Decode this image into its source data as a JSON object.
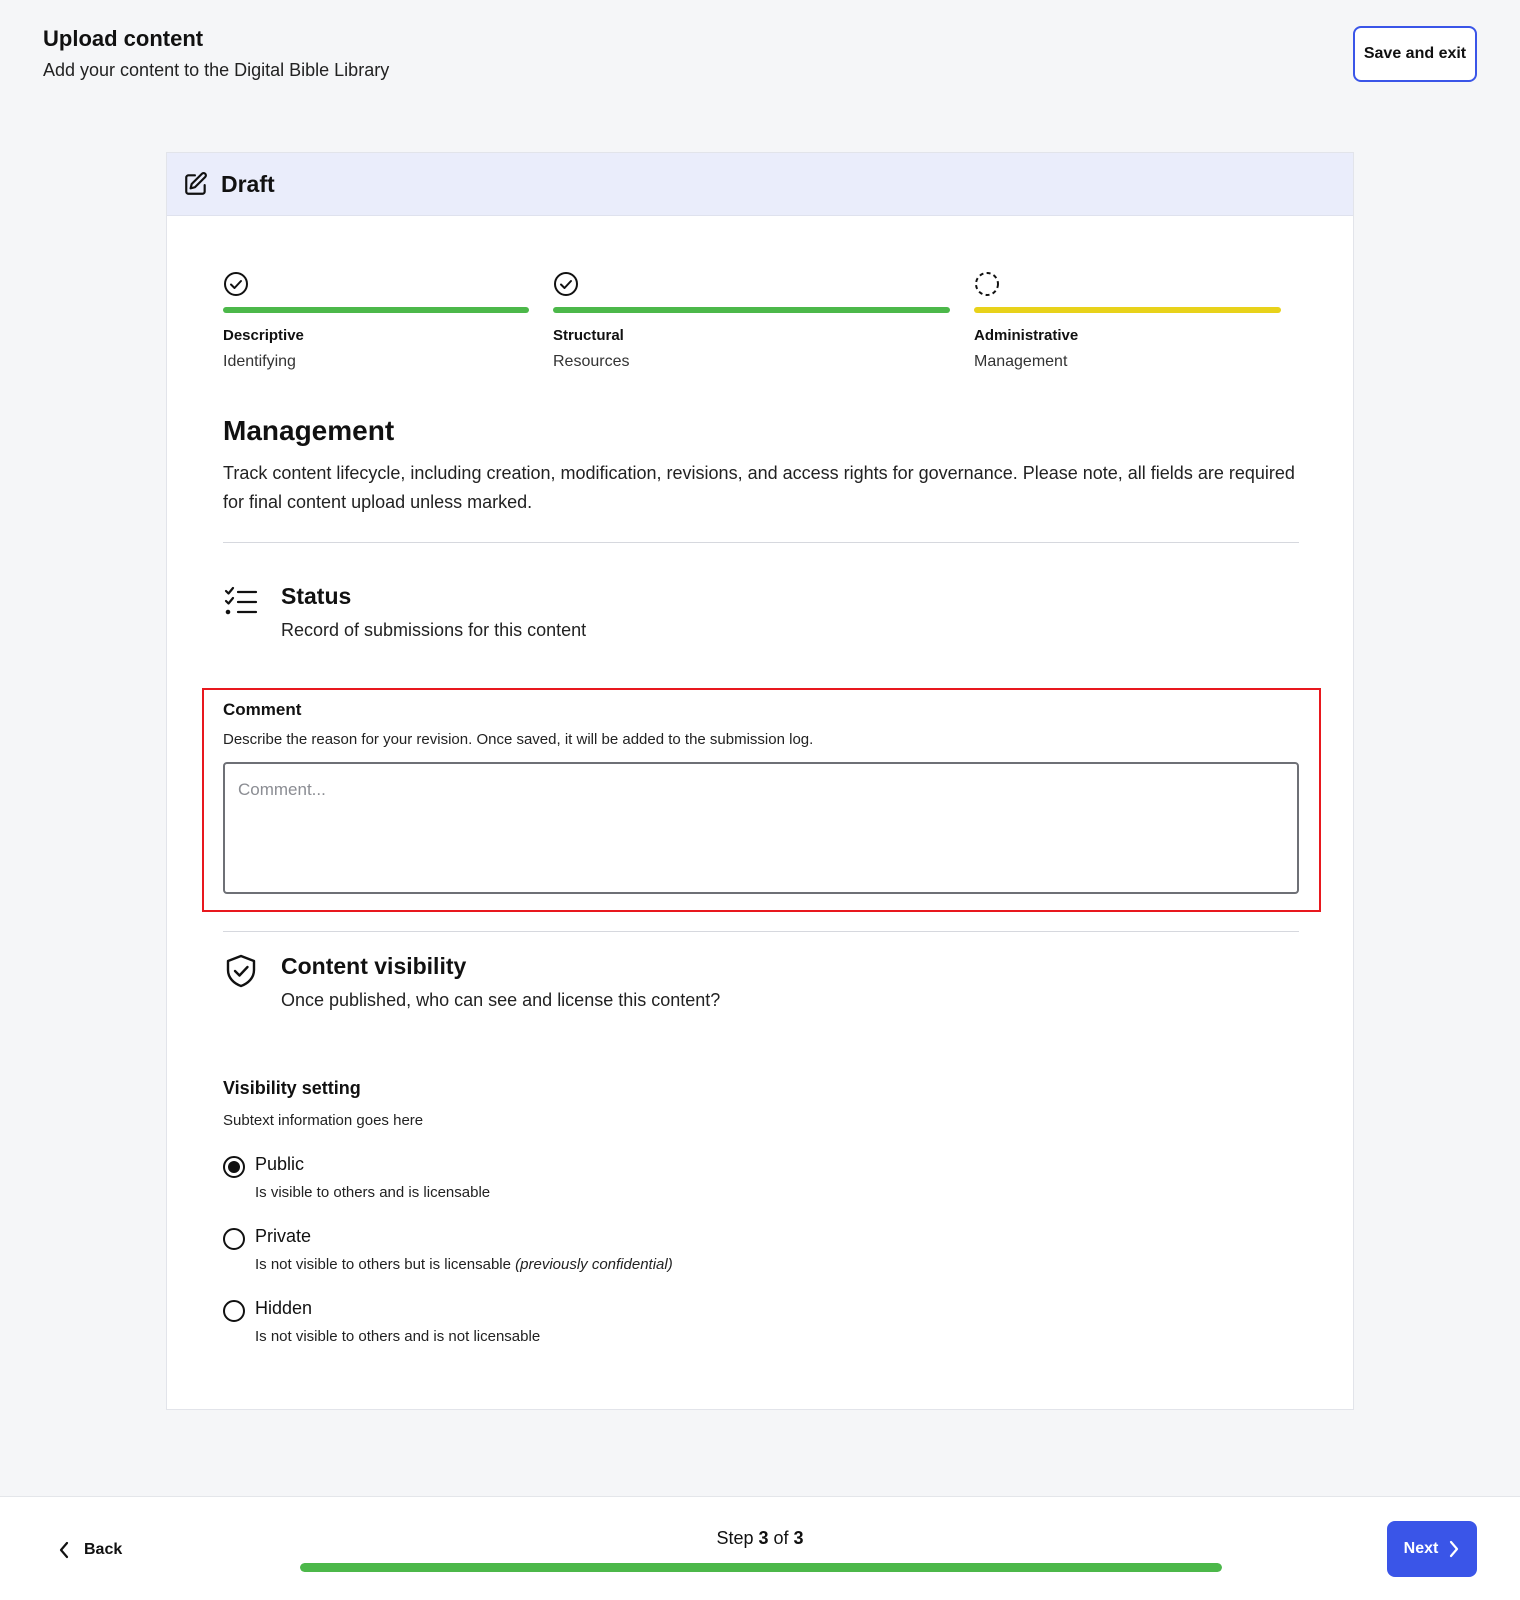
{
  "header": {
    "title": "Upload content",
    "subtitle": "Add your content to the Digital Bible Library",
    "save_exit_label": "Save and exit"
  },
  "card": {
    "status_label": "Draft",
    "status_icon": "edit-icon"
  },
  "stepper": [
    {
      "name": "Descriptive",
      "sub": "Identifying",
      "state": "complete",
      "bar_color": "#4cb84a"
    },
    {
      "name": "Structural",
      "sub": "Resources",
      "state": "complete",
      "bar_color": "#4cb84a"
    },
    {
      "name": "Administrative",
      "sub": "Management",
      "state": "in-progress",
      "bar_color": "#e8d21a"
    }
  ],
  "section": {
    "title": "Management",
    "description": "Track content lifecycle, including creation, modification, revisions, and access rights for governance. Please note, all fields are required for final content upload unless marked."
  },
  "status_group": {
    "title": "Status",
    "description": "Record of submissions for this content",
    "icon": "checklist-icon"
  },
  "comment_field": {
    "label": "Comment",
    "help": "Describe the reason for your revision. Once saved, it will be added to the submission log.",
    "placeholder": "Comment...",
    "value": ""
  },
  "visibility_group": {
    "title": "Content visibility",
    "description": "Once published, who can see and license this content?",
    "icon": "shield-check-icon"
  },
  "visibility_setting": {
    "label": "Visibility setting",
    "help": "Subtext information goes here",
    "selected": "Public",
    "options": [
      {
        "label": "Public",
        "help": "Is visible to others and is licensable",
        "help_note": ""
      },
      {
        "label": "Private",
        "help": "Is not visible to others but is licensable",
        "help_note": "(previously confidential)"
      },
      {
        "label": "Hidden",
        "help": "Is not visible to others and is not licensable",
        "help_note": ""
      }
    ]
  },
  "footer": {
    "back_label": "Back",
    "step_prefix": "Step",
    "step_current": "3",
    "step_of": "of",
    "step_total": "3",
    "progress_fraction": 1.0,
    "next_label": "Next"
  },
  "colors": {
    "accent": "#3a55e8",
    "complete": "#4cb84a",
    "in_progress": "#e8d21a",
    "highlight_outline": "#e8181e"
  }
}
